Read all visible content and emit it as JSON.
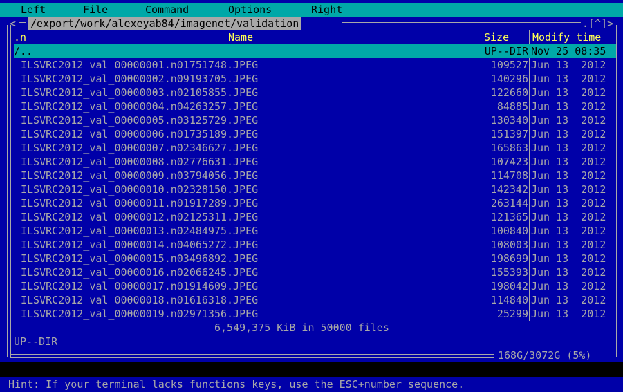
{
  "menu": {
    "left": "Left",
    "file": "File",
    "command": "Command",
    "options": "Options",
    "right": "Right"
  },
  "panel": {
    "path": "/export/work/alexeyab84/imagenet/validation",
    "left_arrow": "<",
    "right_arrow": "-",
    "corner": ".[^]>",
    "col_sort": ".n",
    "col_name": "Name",
    "col_size": "Size",
    "col_modify": "Modify time",
    "rows": [
      {
        "name": "/..",
        "size": "UP--DIR",
        "modify": "Nov 25 08:35",
        "selected": true
      },
      {
        "name": "ILSVRC2012_val_00000001.n01751748.JPEG",
        "size": "109527",
        "modify": "Jun 13  2012"
      },
      {
        "name": "ILSVRC2012_val_00000002.n09193705.JPEG",
        "size": "140296",
        "modify": "Jun 13  2012"
      },
      {
        "name": "ILSVRC2012_val_00000003.n02105855.JPEG",
        "size": "122660",
        "modify": "Jun 13  2012"
      },
      {
        "name": "ILSVRC2012_val_00000004.n04263257.JPEG",
        "size": "84885",
        "modify": "Jun 13  2012"
      },
      {
        "name": "ILSVRC2012_val_00000005.n03125729.JPEG",
        "size": "130340",
        "modify": "Jun 13  2012"
      },
      {
        "name": "ILSVRC2012_val_00000006.n01735189.JPEG",
        "size": "151397",
        "modify": "Jun 13  2012"
      },
      {
        "name": "ILSVRC2012_val_00000007.n02346627.JPEG",
        "size": "165863",
        "modify": "Jun 13  2012"
      },
      {
        "name": "ILSVRC2012_val_00000008.n02776631.JPEG",
        "size": "107423",
        "modify": "Jun 13  2012"
      },
      {
        "name": "ILSVRC2012_val_00000009.n03794056.JPEG",
        "size": "114708",
        "modify": "Jun 13  2012"
      },
      {
        "name": "ILSVRC2012_val_00000010.n02328150.JPEG",
        "size": "142342",
        "modify": "Jun 13  2012"
      },
      {
        "name": "ILSVRC2012_val_00000011.n01917289.JPEG",
        "size": "263144",
        "modify": "Jun 13  2012"
      },
      {
        "name": "ILSVRC2012_val_00000012.n02125311.JPEG",
        "size": "121365",
        "modify": "Jun 13  2012"
      },
      {
        "name": "ILSVRC2012_val_00000013.n02484975.JPEG",
        "size": "100840",
        "modify": "Jun 13  2012"
      },
      {
        "name": "ILSVRC2012_val_00000014.n04065272.JPEG",
        "size": "108003",
        "modify": "Jun 13  2012"
      },
      {
        "name": "ILSVRC2012_val_00000015.n03496892.JPEG",
        "size": "198699",
        "modify": "Jun 13  2012"
      },
      {
        "name": "ILSVRC2012_val_00000016.n02066245.JPEG",
        "size": "155393",
        "modify": "Jun 13  2012"
      },
      {
        "name": "ILSVRC2012_val_00000017.n01914609.JPEG",
        "size": "198042",
        "modify": "Jun 13  2012"
      },
      {
        "name": "ILSVRC2012_val_00000018.n01616318.JPEG",
        "size": "114840",
        "modify": "Jun 13  2012"
      },
      {
        "name": "ILSVRC2012_val_00000019.n02971356.JPEG",
        "size": "25299",
        "modify": "Jun 13  2012"
      }
    ],
    "summary": "6,549,375 KiB in 50000 files",
    "mini_status": "UP--DIR",
    "disk_usage": "168G/3072G (5%)"
  },
  "hint": "Hint: If your terminal lacks functions keys, use the ESC+number sequence.",
  "colors": {
    "panel_bg": "#0000a8",
    "menu_bg": "#00a8a8",
    "header_text": "#ffff55",
    "text": "#a8a8a8",
    "selection_bg": "#00a8a8"
  }
}
